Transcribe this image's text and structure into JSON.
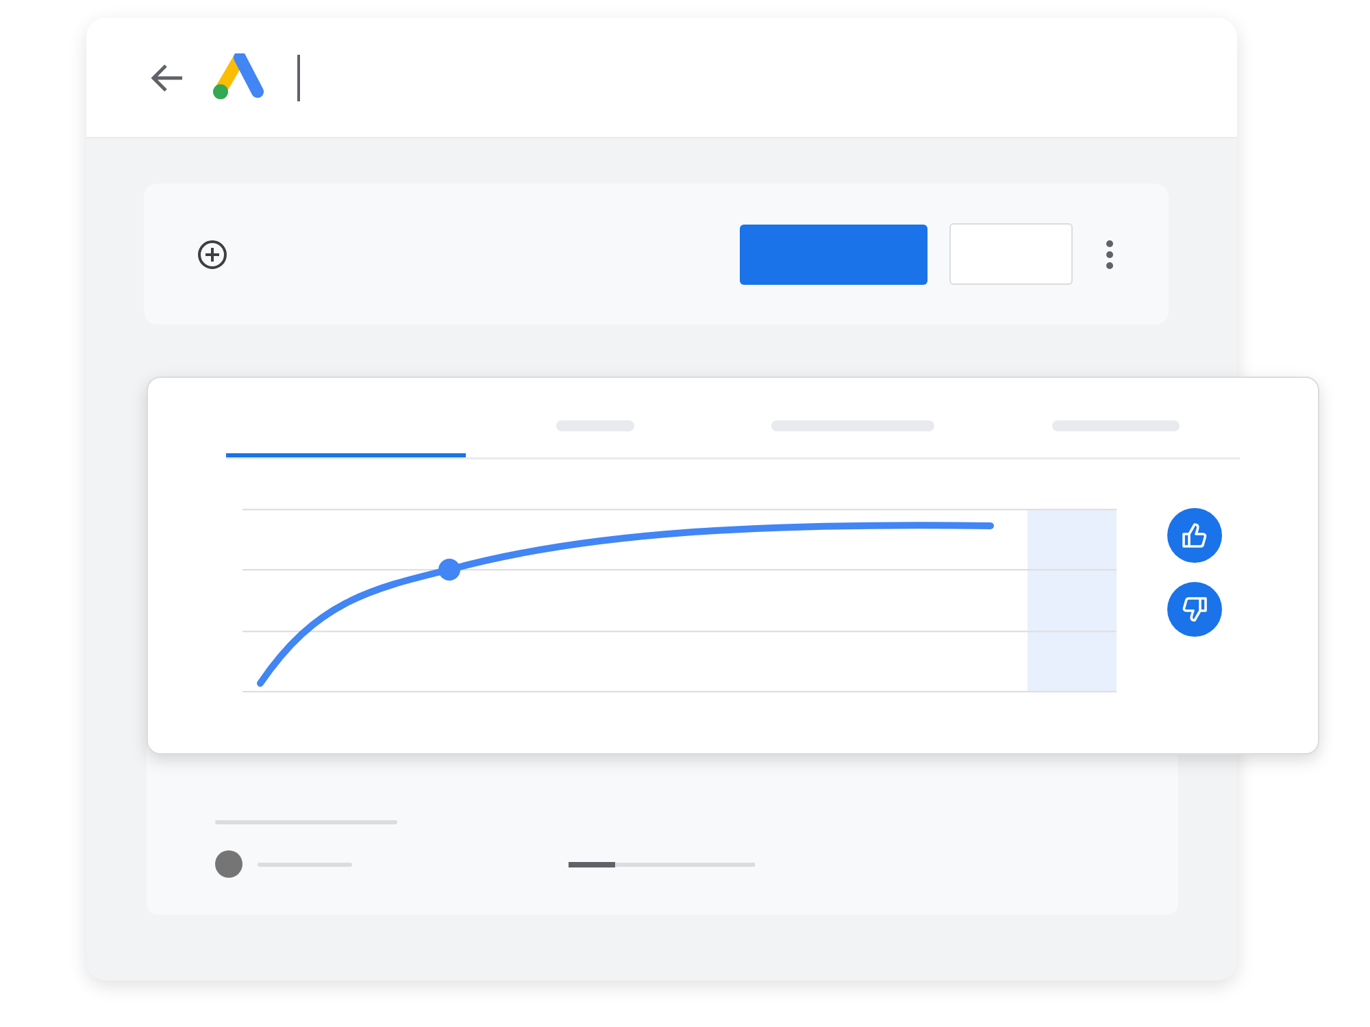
{
  "tabs": [
    {
      "selected": true
    },
    {
      "selected": false
    },
    {
      "selected": false
    },
    {
      "selected": false
    }
  ],
  "progress": {
    "level": 0.25
  }
}
